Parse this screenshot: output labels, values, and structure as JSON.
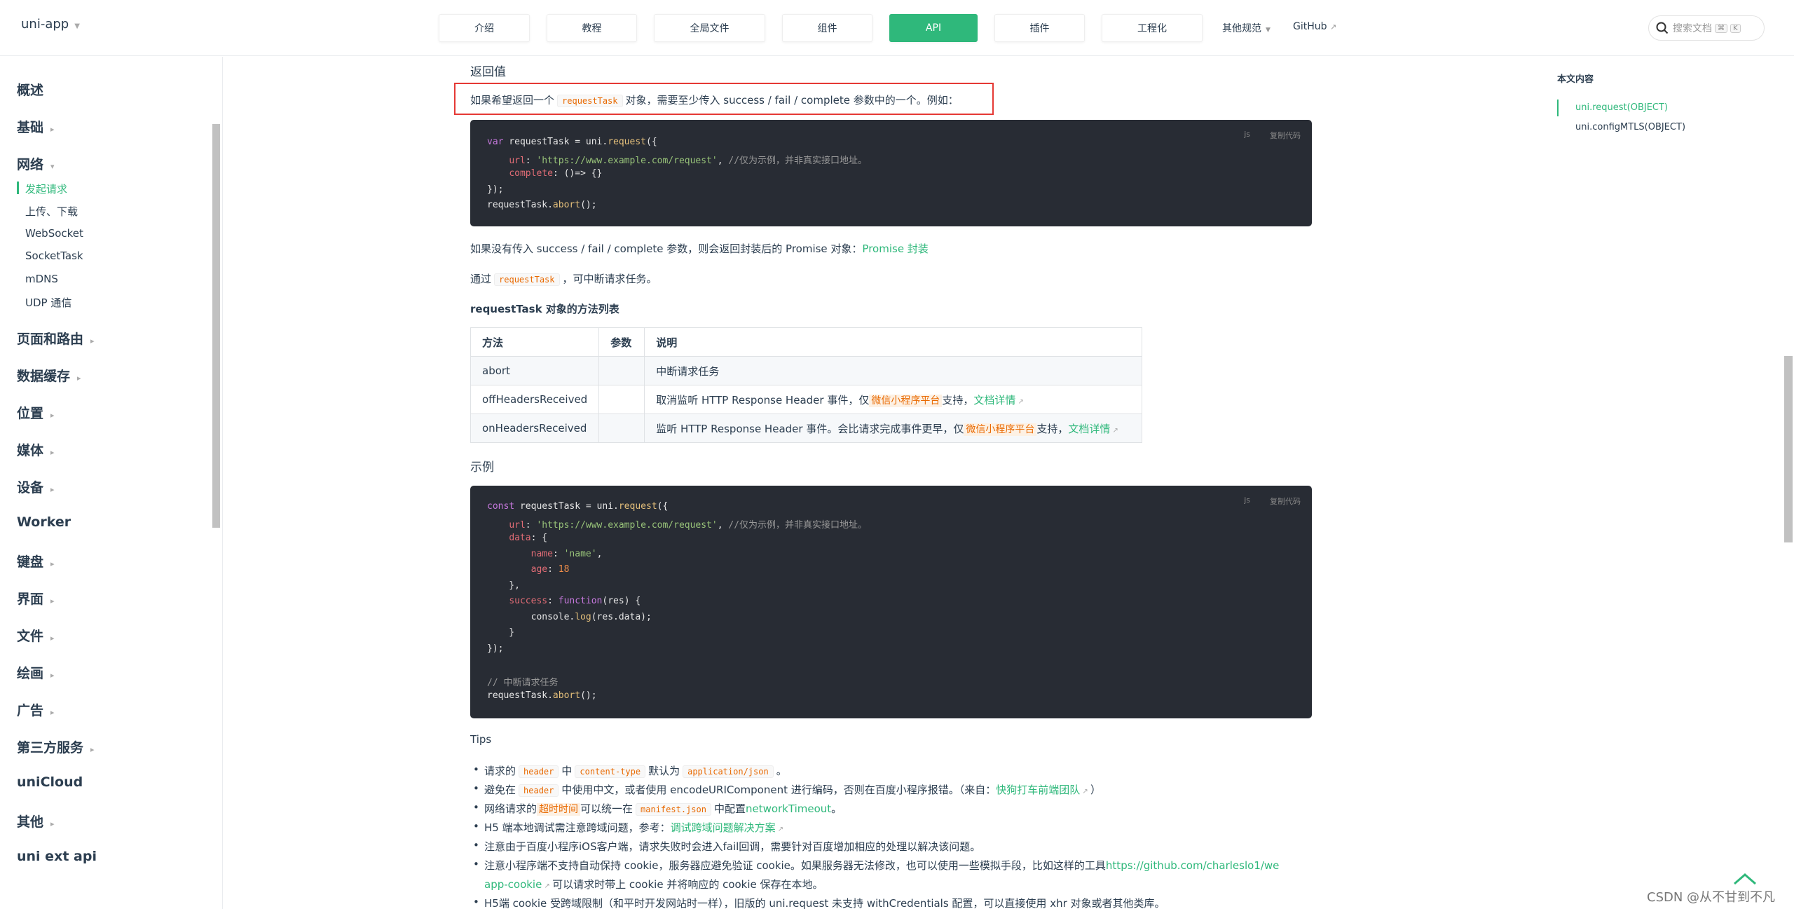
{
  "header": {
    "logo": "uni-app",
    "nav": [
      "介绍",
      "教程",
      "全局文件",
      "组件",
      "API",
      "插件",
      "工程化"
    ],
    "nav_active": "API",
    "other_spec": "其他规范",
    "github": "GitHub",
    "search_placeholder": "搜索文档",
    "kbd1": "⌘",
    "kbd2": "K"
  },
  "sidebar": {
    "items": [
      "概述",
      "基础",
      "网络",
      "页面和路由",
      "数据缓存",
      "位置",
      "媒体",
      "设备",
      "Worker",
      "键盘",
      "界面",
      "文件",
      "绘画",
      "广告",
      "第三方服务",
      "uniCloud",
      "其他",
      "uni ext api"
    ],
    "network_sub": [
      "发起请求",
      "上传、下载",
      "WebSocket",
      "SocketTask",
      "mDNS",
      "UDP 通信"
    ]
  },
  "main": {
    "return_title": "返回值",
    "intro_1": "如果希望返回一个",
    "intro_code": "requestTask",
    "intro_2": "对象，需要至少传入 success / fail / complete 参数中的一个。例如：",
    "code1_lang": "js",
    "code1_copy": "复制代码",
    "promise_text": "如果没有传入 success / fail / complete 参数，则会返回封装后的 Promise 对象：",
    "promise_link": "Promise 封装",
    "abort_1": "通过",
    "abort_code": "requestTask",
    "abort_2": "，可中断请求任务。",
    "methods_title": "requestTask 对象的方法列表",
    "table": {
      "headers": [
        "方法",
        "参数",
        "说明"
      ],
      "rows": [
        {
          "method": "abort",
          "param": "",
          "desc": "中断请求任务"
        },
        {
          "method": "offHeadersReceived",
          "param": "",
          "desc_1": "取消监听 HTTP Response Header 事件，仅",
          "tag": "微信小程序平台",
          "desc_2": "支持，",
          "link": "文档详情"
        },
        {
          "method": "onHeadersReceived",
          "param": "",
          "desc_1": "监听 HTTP Response Header 事件。会比请求完成事件更早，仅",
          "tag": "微信小程序平台",
          "desc_2": "支持，",
          "link": "文档详情"
        }
      ]
    },
    "example_title": "示例",
    "code2_lang": "js",
    "code2_copy": "复制代码",
    "tips_title": "Tips",
    "tips": {
      "t1_a": "请求的",
      "t1_c1": "header",
      "t1_b": "中",
      "t1_c2": "content-type",
      "t1_c": "默认为",
      "t1_c3": "application/json",
      "t1_d": "。",
      "t2_a": "避免在",
      "t2_c1": "header",
      "t2_b": "中使用中文，或者使用 encodeURIComponent 进行编码，否则在百度小程序报错。（来自：",
      "t2_link": "快狗打车前端团队",
      "t2_c": "）",
      "t3_a": "网络请求的",
      "t3_tag": "超时时间",
      "t3_b": "可以统一在",
      "t3_c1": "manifest.json",
      "t3_c": "中配置",
      "t3_link": "networkTimeout",
      "t3_d": "。",
      "t4_a": "H5 端本地调试需注意跨域问题，参考：",
      "t4_link": "调试跨域问题解决方案",
      "t5": "注意由于百度小程序iOS客户端，请求失败时会进入fail回调，需要针对百度增加相应的处理以解决该问题。",
      "t6_a": "注意小程序端不支持自动保持 cookie，服务器应避免验证 cookie。如果服务器无法修改，也可以使用一些模拟手段，比如这样的工具",
      "t6_link": "https://github.com/charleslo1/we",
      "t6_link2": "app-cookie",
      "t6_b": "可以请求时带上 cookie 并将响应的 cookie 保存在本地。",
      "t7": "H5端 cookie 受跨域限制（和平时开发网站时一样），旧版的 uni.request 未支持 withCredentials 配置，可以直接使用 xhr 对象或者其他类库。"
    }
  },
  "toc": {
    "title": "本文内容",
    "items": [
      "uni.request(OBJECT)",
      "uni.configMTLS(OBJECT)"
    ]
  },
  "watermark": "CSDN @从不甘到不凡",
  "colors": {
    "accent": "#2fb87b",
    "code_bg": "#282c34",
    "highlight_border": "#e53935"
  }
}
